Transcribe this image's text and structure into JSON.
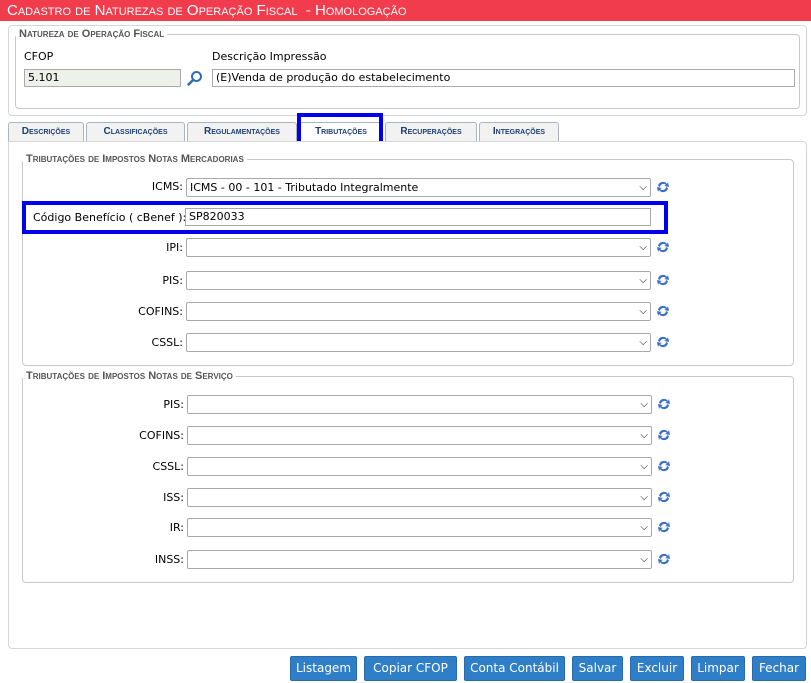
{
  "window": {
    "title": "Cadastro de Naturezas de Operação Fiscal  - Homologação"
  },
  "natureza": {
    "legend": "Natureza de Operação Fiscal",
    "cfop_label": "CFOP",
    "cfop_value": "5.101",
    "descricao_label": "Descrição Impressão",
    "descricao_value": "(E)Venda de produção do estabelecimento"
  },
  "tabs": [
    {
      "label": "Descrições"
    },
    {
      "label": "Classificações"
    },
    {
      "label": "Regulamentações"
    },
    {
      "label": "Tributações"
    },
    {
      "label": "Recuperações"
    },
    {
      "label": "Integrações"
    }
  ],
  "mercadorias": {
    "legend": "Tributações de Impostos Notas Mercadorias",
    "icms_label": "ICMS:",
    "icms_value": "ICMS - 00 - 101 - Tributado Integralmente",
    "cbenef_label": "Código Benefício ( cBenef ):",
    "cbenef_value": "SP820033",
    "ipi_label": "IPI:",
    "pis_label": "PIS:",
    "cofins_label": "COFINS:",
    "cssl_label": "CSSL:"
  },
  "servico": {
    "legend": "Tributações de Impostos Notas de Serviço",
    "pis_label": "PIS:",
    "cofins_label": "COFINS:",
    "cssl_label": "CSSL:",
    "iss_label": "ISS:",
    "ir_label": "IR:",
    "inss_label": "INSS:"
  },
  "buttons": {
    "listagem": "Listagem",
    "copiar": "Copiar CFOP",
    "conta": "Conta Contábil",
    "salvar": "Salvar",
    "excluir": "Excluir",
    "limpar": "Limpar",
    "fechar": "Fechar"
  },
  "icons": {
    "search": "search-icon",
    "refresh": "refresh-icon"
  },
  "colors": {
    "title_bg": "#f03c4c",
    "button_bg": "#2f7fc8",
    "highlight": "#0000ee",
    "tab_text": "#1c3f74"
  }
}
